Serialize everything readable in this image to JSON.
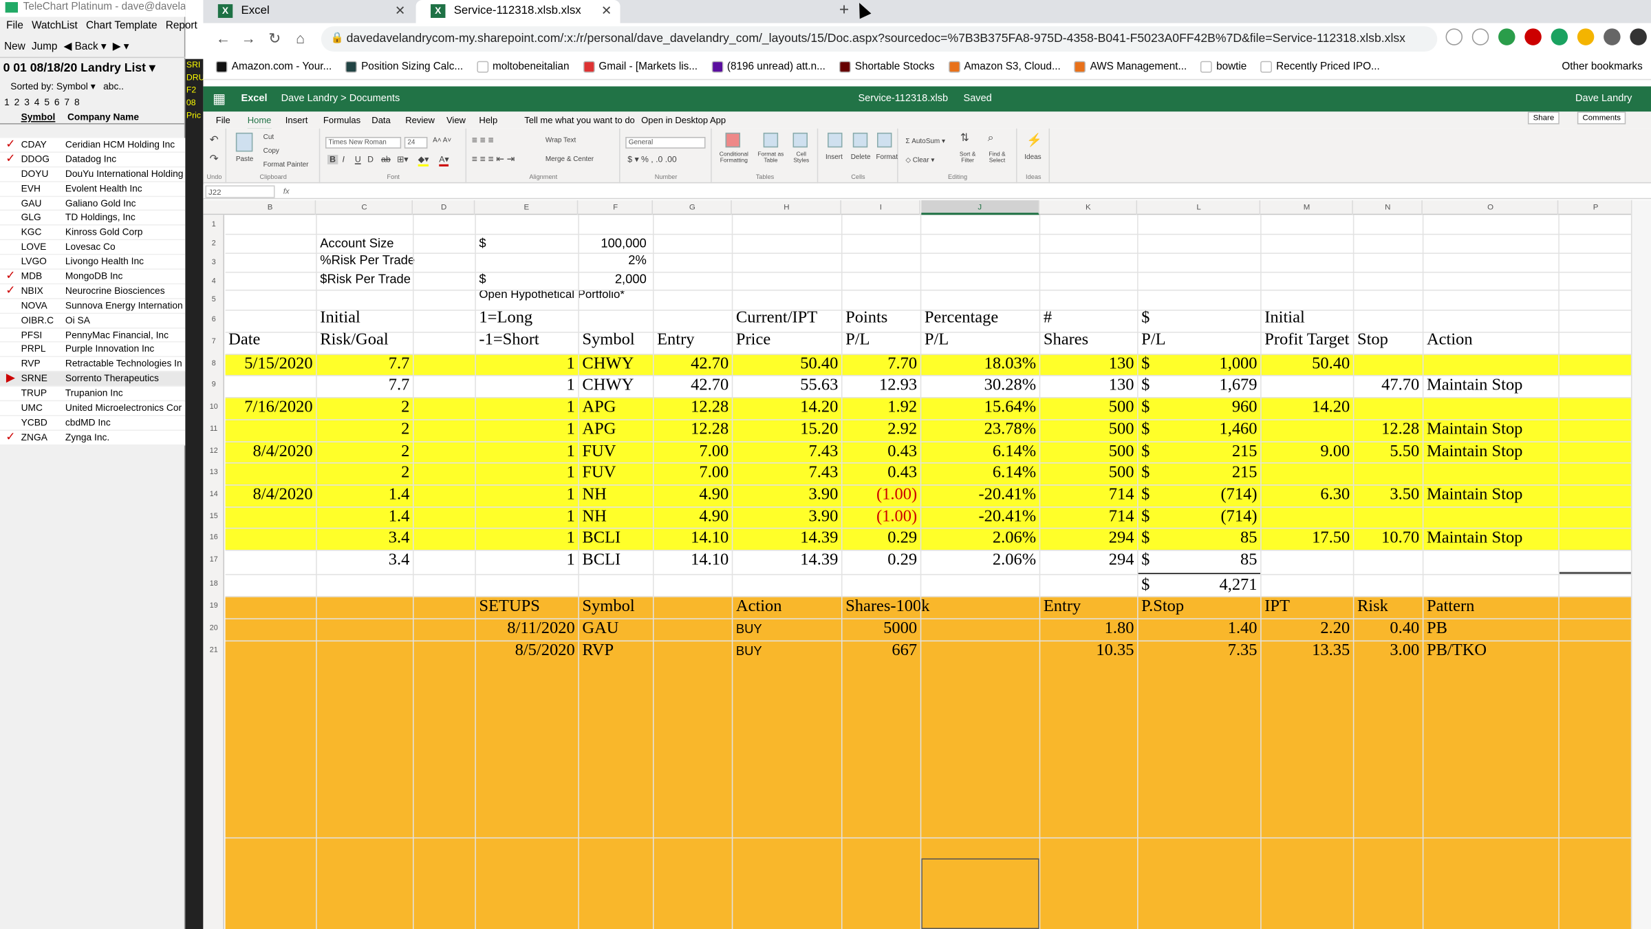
{
  "telechart": {
    "title": "TeleChart Platinum - dave@davelandry",
    "menu": [
      "File",
      "WatchList",
      "Chart Template",
      "Report"
    ],
    "toolbar": [
      "New",
      "Jump",
      "Back"
    ],
    "list_title": "0 01 08/18/20 Landry List",
    "sorted_by": "Sorted by: Symbol",
    "sort_toggle": "abc..",
    "numbers": "1 2 3 4 5 6 7 8",
    "col_symbol": "Symbol",
    "col_company": "Company Name",
    "strip_text": [
      "SRI",
      "DRU",
      "F2",
      "08",
      "Pric"
    ],
    "rows": [
      {
        "checked": true,
        "symbol": "CDAY",
        "company": "Ceridian HCM Holding Inc"
      },
      {
        "checked": true,
        "symbol": "DDOG",
        "company": "Datadog Inc"
      },
      {
        "checked": false,
        "symbol": "DOYU",
        "company": "DouYu International Holding"
      },
      {
        "checked": false,
        "symbol": "EVH",
        "company": "Evolent Health Inc"
      },
      {
        "checked": false,
        "symbol": "GAU",
        "company": "Galiano Gold Inc"
      },
      {
        "checked": false,
        "symbol": "GLG",
        "company": "TD Holdings, Inc"
      },
      {
        "checked": false,
        "symbol": "KGC",
        "company": "Kinross Gold Corp"
      },
      {
        "checked": false,
        "symbol": "LOVE",
        "company": "Lovesac Co"
      },
      {
        "checked": false,
        "symbol": "LVGO",
        "company": "Livongo Health Inc"
      },
      {
        "checked": true,
        "symbol": "MDB",
        "company": "MongoDB Inc"
      },
      {
        "checked": true,
        "symbol": "NBIX",
        "company": "Neurocrine Biosciences"
      },
      {
        "checked": false,
        "symbol": "NOVA",
        "company": "Sunnova Energy Internation"
      },
      {
        "checked": false,
        "symbol": "OIBR.C",
        "company": "Oi SA"
      },
      {
        "checked": false,
        "symbol": "PFSI",
        "company": "PennyMac Financial, Inc"
      },
      {
        "checked": false,
        "symbol": "PRPL",
        "company": "Purple Innovation Inc"
      },
      {
        "checked": false,
        "symbol": "RVP",
        "company": "Retractable Technologies In"
      },
      {
        "checked": false,
        "symbol": "SRNE",
        "company": "Sorrento Therapeutics"
      },
      {
        "checked": false,
        "symbol": "TRUP",
        "company": "Trupanion Inc"
      },
      {
        "checked": false,
        "symbol": "UMC",
        "company": "United Microelectronics Cor"
      },
      {
        "checked": false,
        "symbol": "YCBD",
        "company": "cbdMD Inc"
      },
      {
        "checked": true,
        "symbol": "ZNGA",
        "company": "Zynga Inc."
      }
    ]
  },
  "browser": {
    "tabs": [
      {
        "label": "Excel"
      },
      {
        "label": "Service-112318.xlsb.xlsx"
      }
    ],
    "url": "davedavelandrycom-my.sharepoint.com/:x:/r/personal/dave_davelandry_com/_layouts/15/Doc.aspx?sourcedoc=%7B3B375FA8-975D-4358-B041-F5023A0FF42B%7D&file=Service-112318.xlsb.xlsx",
    "bookmarks": [
      {
        "label": "Amazon.com - Your...",
        "color": "#111"
      },
      {
        "label": "Position Sizing Calc...",
        "color": "#244"
      },
      {
        "label": "moltobeneitalian",
        "color": "#fff"
      },
      {
        "label": "Gmail - [Markets lis...",
        "color": "#d33"
      },
      {
        "label": "(8196 unread) att.n...",
        "color": "#5a0f9e"
      },
      {
        "label": "Shortable Stocks",
        "color": "#600"
      },
      {
        "label": "Amazon S3, Cloud...",
        "color": "#e8711a"
      },
      {
        "label": "AWS Management...",
        "color": "#e8711a"
      },
      {
        "label": "bowtie",
        "color": "#fff"
      },
      {
        "label": "Recently Priced IPO...",
        "color": "#fff"
      }
    ],
    "other_bookmarks": "Other bookmarks"
  },
  "excel": {
    "app": "Excel",
    "breadcrumb": "Dave Landry  >  Documents",
    "file": "Service-112318.xlsb",
    "saved": "Saved",
    "user": "Dave Landry",
    "tabs": [
      "File",
      "Home",
      "Insert",
      "Formulas",
      "Data",
      "Review",
      "View",
      "Help",
      "Tell me what you want to do",
      "Open in Desktop App"
    ],
    "share": "Share",
    "comments": "Comments",
    "font_name": "Times New Roman",
    "font_size": "24",
    "number_format": "General",
    "name_box": "J22",
    "ribbon": {
      "paste": "Paste",
      "cut": "Cut",
      "copy": "Copy",
      "format_painter": "Format Painter",
      "wrap": "Wrap Text",
      "merge": "Merge & Center",
      "cond": "Conditional Formatting",
      "fmt_table": "Format as Table",
      "cell_styles": "Cell Styles",
      "insert": "Insert",
      "delete": "Delete",
      "format": "Format",
      "autosum": "AutoSum",
      "clear": "Clear",
      "sort": "Sort & Filter",
      "find": "Find & Select",
      "ideas": "Ideas",
      "g_undo": "Undo",
      "g_clip": "Clipboard",
      "g_font": "Font",
      "g_align": "Alignment",
      "g_num": "Number",
      "g_tables": "Tables",
      "g_cells": "Cells",
      "g_edit": "Editing",
      "g_ideas": "Ideas"
    },
    "columns": [
      "B",
      "C",
      "D",
      "E",
      "F",
      "G",
      "H",
      "I",
      "J",
      "K",
      "L",
      "M",
      "N",
      "O",
      "P"
    ],
    "row_numbers": [
      "1",
      "2",
      "3",
      "4",
      "5",
      "6",
      "7",
      "8",
      "9",
      "10",
      "11",
      "12",
      "13",
      "14",
      "15",
      "16",
      "17",
      "18",
      "19",
      "20",
      "21"
    ],
    "top": {
      "account_size_label": "Account Size",
      "account_size_cur": "$",
      "account_size": "100,000",
      "risk_pct_label": "%Risk Per Trade",
      "risk_pct": "2%",
      "risk_dollar_label": "$Risk Per Trade",
      "risk_dollar_cur": "$",
      "risk_dollar": "2,000",
      "portfolio_title": "Open Hypothetical Portfolio*"
    },
    "headers": {
      "row5": {
        "initial": "Initial",
        "long": "1=Long",
        "current": "Current/IPT",
        "points": "Points",
        "percentage": "Percentage",
        "num": "#",
        "dollar": "$",
        "initial2": "Initial"
      },
      "row6": {
        "date": "Date",
        "risk_goal": "Risk/Goal",
        "short": "-1=Short",
        "symbol": "Symbol",
        "entry": "Entry",
        "price": "Price",
        "pl": "P/L",
        "pl2": "P/L",
        "shares": "Shares",
        "pl3": "P/L",
        "profit_target": "Profit Target",
        "stop": "Stop",
        "action": "Action"
      }
    },
    "positions": [
      {
        "date": "5/15/2020",
        "risk": "7.7",
        "dir": "1",
        "symbol": "CHWY",
        "entry": "42.70",
        "price": "50.40",
        "points": "7.70",
        "pct": "18.03%",
        "shares": "130",
        "cur": "$",
        "pl": "1,000",
        "target": "50.40",
        "stop": "",
        "action": "",
        "hl": false,
        "neg": false
      },
      {
        "date": "",
        "risk": "7.7",
        "dir": "1",
        "symbol": "CHWY",
        "entry": "42.70",
        "price": "55.63",
        "points": "12.93",
        "pct": "30.28%",
        "shares": "130",
        "cur": "$",
        "pl": "1,679",
        "target": "",
        "stop": "47.70",
        "action": "Maintain Stop",
        "hl": true,
        "neg": false
      },
      {
        "date": "7/16/2020",
        "risk": "2",
        "dir": "1",
        "symbol": "APG",
        "entry": "12.28",
        "price": "14.20",
        "points": "1.92",
        "pct": "15.64%",
        "shares": "500",
        "cur": "$",
        "pl": "960",
        "target": "14.20",
        "stop": "",
        "action": "",
        "hl": false,
        "neg": false
      },
      {
        "date": "",
        "risk": "2",
        "dir": "1",
        "symbol": "APG",
        "entry": "12.28",
        "price": "15.20",
        "points": "2.92",
        "pct": "23.78%",
        "shares": "500",
        "cur": "$",
        "pl": "1,460",
        "target": "",
        "stop": "12.28",
        "action": "Maintain Stop",
        "hl": true,
        "neg": false
      },
      {
        "date": "8/4/2020",
        "risk": "2",
        "dir": "1",
        "symbol": "FUV",
        "entry": "7.00",
        "price": "7.43",
        "points": "0.43",
        "pct": "6.14%",
        "shares": "500",
        "cur": "$",
        "pl": "215",
        "target": "9.00",
        "stop": "5.50",
        "action": "Maintain Stop",
        "hl": true,
        "neg": false
      },
      {
        "date": "",
        "risk": "2",
        "dir": "1",
        "symbol": "FUV",
        "entry": "7.00",
        "price": "7.43",
        "points": "0.43",
        "pct": "6.14%",
        "shares": "500",
        "cur": "$",
        "pl": "215",
        "target": "",
        "stop": "",
        "action": "",
        "hl": true,
        "neg": false
      },
      {
        "date": "8/4/2020",
        "risk": "1.4",
        "dir": "1",
        "symbol": "NH",
        "entry": "4.90",
        "price": "3.90",
        "points": "(1.00)",
        "pct": "-20.41%",
        "shares": "714",
        "cur": "$",
        "pl": "(714)",
        "target": "6.30",
        "stop": "3.50",
        "action": "Maintain Stop",
        "hl": true,
        "neg": true
      },
      {
        "date": "",
        "risk": "1.4",
        "dir": "1",
        "symbol": "NH",
        "entry": "4.90",
        "price": "3.90",
        "points": "(1.00)",
        "pct": "-20.41%",
        "shares": "714",
        "cur": "$",
        "pl": "(714)",
        "target": "",
        "stop": "",
        "action": "",
        "hl": true,
        "neg": true
      },
      {
        "date": "",
        "risk": "3.4",
        "dir": "1",
        "symbol": "BCLI",
        "entry": "14.10",
        "price": "14.39",
        "points": "0.29",
        "pct": "2.06%",
        "shares": "294",
        "cur": "$",
        "pl": "85",
        "target": "17.50",
        "stop": "10.70",
        "action": "Maintain Stop",
        "hl": true,
        "neg": false
      },
      {
        "date": "",
        "risk": "3.4",
        "dir": "1",
        "symbol": "BCLI",
        "entry": "14.10",
        "price": "14.39",
        "points": "0.29",
        "pct": "2.06%",
        "shares": "294",
        "cur": "$",
        "pl": "85",
        "target": "",
        "stop": "",
        "action": "",
        "hl": true,
        "neg": false
      }
    ],
    "total": {
      "cur": "$",
      "value": "4,271"
    },
    "setups_header": {
      "setups": "SETUPS",
      "symbol": "Symbol",
      "action": "Action",
      "shares": "Shares-100k",
      "entry": "Entry",
      "pstop": "P.Stop",
      "ipt": "IPT",
      "risk": "Risk",
      "pattern": "Pattern"
    },
    "setups": [
      {
        "date": "8/11/2020",
        "symbol": "GAU",
        "action": "BUY",
        "shares": "5000",
        "entry": "1.80",
        "pstop": "1.40",
        "ipt": "2.20",
        "risk": "0.40",
        "pattern": "PB"
      },
      {
        "date": "8/5/2020",
        "symbol": "RVP",
        "action": "BUY",
        "shares": "667",
        "entry": "10.35",
        "pstop": "7.35",
        "ipt": "13.35",
        "risk": "3.00",
        "pattern": "PB/TKO"
      }
    ],
    "colors": {
      "highlight": "#ffff29",
      "setups_bg": "#f9b72b",
      "negative": "#cc0000",
      "excel_green": "#217346"
    }
  }
}
